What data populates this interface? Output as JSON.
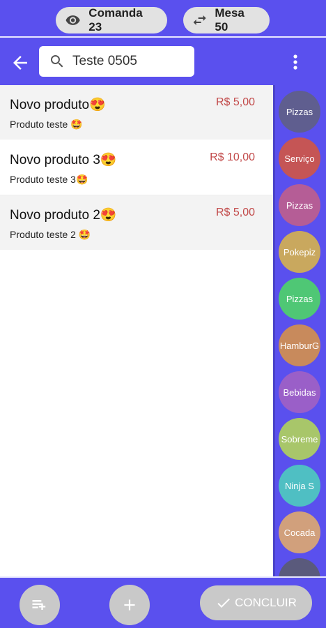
{
  "header": {
    "comanda_label": "Comanda 23",
    "mesa_label": "Mesa 50"
  },
  "search": {
    "value": "Teste 0505"
  },
  "products": [
    {
      "name": "Novo produto😍",
      "description": "Produto teste 🤩",
      "price": "R$ 5,00"
    },
    {
      "name": "Novo produto 3😍",
      "description": "Produto teste 3🤩",
      "price": "R$ 10,00"
    },
    {
      "name": "Novo produto 2😍",
      "description": "Produto teste 2 🤩",
      "price": "R$ 5,00"
    }
  ],
  "categories": [
    {
      "label": "Pizzas",
      "color": "#5f5e8f"
    },
    {
      "label": "Serviço",
      "color": "#c55555"
    },
    {
      "label": "Pizzas",
      "color": "#b55d96"
    },
    {
      "label": "Pokepiz",
      "color": "#c9a85e"
    },
    {
      "label": "Pizzas",
      "color": "#4fc775"
    },
    {
      "label": "HamburG",
      "color": "#c88a5c"
    },
    {
      "label": "Bebidas",
      "color": "#9a5fc8"
    },
    {
      "label": "Sobreme",
      "color": "#a8c66a"
    },
    {
      "label": "Ninja S",
      "color": "#4fbfc3"
    },
    {
      "label": "Cocada",
      "color": "#d1a07c"
    },
    {
      "label": "",
      "color": "#5a5a7c"
    }
  ],
  "footer": {
    "concluir_label": "CONCLUIR"
  },
  "colors": {
    "primary": "#5a50ee",
    "price": "#c24a4a",
    "chip": "#e2e2e2",
    "fab": "#c9c9c9"
  }
}
